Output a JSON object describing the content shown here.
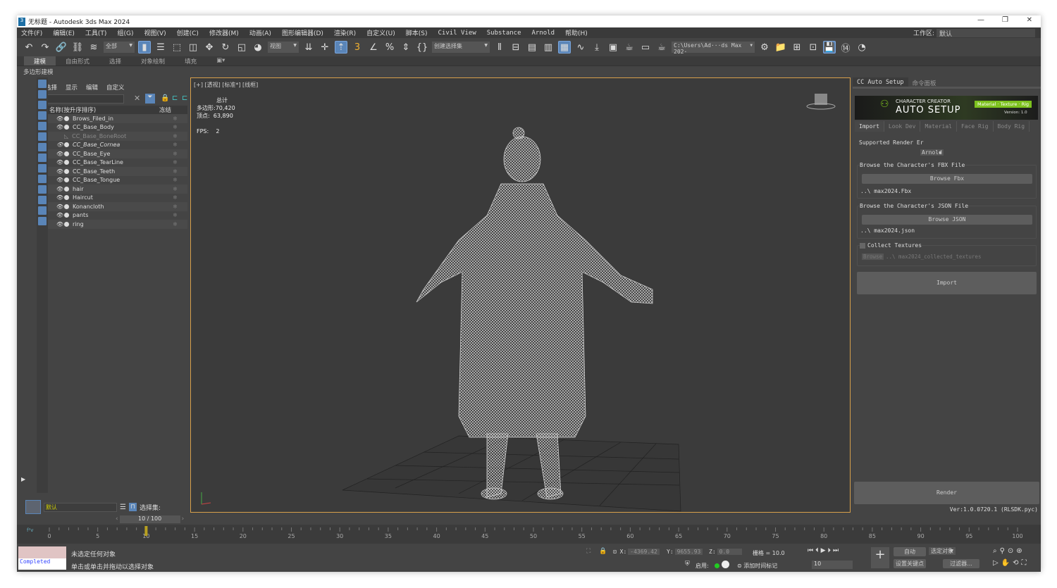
{
  "window": {
    "title": "无标题 - Autodesk 3ds Max 2024"
  },
  "menu": [
    "文件(F)",
    "编辑(E)",
    "工具(T)",
    "组(G)",
    "视图(V)",
    "创建(C)",
    "修改器(M)",
    "动画(A)",
    "图形编辑器(D)",
    "渲染(R)",
    "自定义(U)",
    "脚本(S)",
    "Civil View",
    "Substance",
    "Arnold",
    "帮助(H)"
  ],
  "workspace": {
    "label": "工作区:",
    "value": "默认"
  },
  "toolbar": {
    "filter": "全部",
    "refcoord": "视图",
    "selset": "创建选择集",
    "path": "C:\\Users\\Ad···ds Max 202·"
  },
  "ribbon": {
    "tabs": [
      "建模",
      "自由形式",
      "选择",
      "对象绘制",
      "填充"
    ],
    "active": 0,
    "sub": "多边形建模"
  },
  "explorer": {
    "menu": [
      "选择",
      "显示",
      "编辑",
      "自定义"
    ],
    "col_name": "名称(按升序排序)",
    "col_freeze": "冻结",
    "items": [
      {
        "name": "Brows_Filed_in"
      },
      {
        "name": "CC_Base_Body"
      },
      {
        "name": "CC_Base_BoneRoot",
        "hidden": true
      },
      {
        "name": "CC_Base_Cornea",
        "italic": true
      },
      {
        "name": "CC_Base_Eye"
      },
      {
        "name": "CC_Base_TearLine"
      },
      {
        "name": "CC_Base_Teeth"
      },
      {
        "name": "CC_Base_Tongue"
      },
      {
        "name": "hair"
      },
      {
        "name": "Haircut"
      },
      {
        "name": "Konancloth"
      },
      {
        "name": "pants"
      },
      {
        "name": "ring"
      }
    ],
    "layer": "默认",
    "selset_label": "选择集:"
  },
  "viewport": {
    "label": "[+] [透视] [标准*] [线框]",
    "stats_title": "总计",
    "poly_label": "多边形:",
    "poly": "70,420",
    "vert_label": "顶点:",
    "vert": "63,890",
    "fps_label": "FPS:",
    "fps": "2"
  },
  "panel": {
    "tabs": [
      "CC Auto Setup",
      "命令面板"
    ],
    "banner_top": "CHARACTER CREATOR",
    "banner_main": "AUTO SETUP",
    "banner_badge": "Material · Texture · Rig",
    "version_small": "Version: 1.0",
    "subtabs": [
      "Import",
      "Look Dev",
      "Material",
      "Face Rig",
      "Body Rig"
    ],
    "render_label": "Supported Render Er",
    "render_value": "Arnold",
    "fbx_title": "Browse the Character's FBX File",
    "fbx_btn": "Browse Fbx",
    "fbx_path": "..\\ max2024.Fbx",
    "json_title": "Browse the Character's JSON File",
    "json_btn": "Browse JSON",
    "json_path": "..\\ max2024.json",
    "collect": "Collect Textures",
    "collect_btn": "Browse",
    "collect_path": "..\\ max2024_collected_textures",
    "import": "Import",
    "render": "Render",
    "ver": "Ver:1.0.0720.1 (RLSDK.pyc)"
  },
  "timeline": {
    "frame": "10 / 100",
    "current": 10,
    "max": 100,
    "ticks": [
      "0",
      "5",
      "10",
      "15",
      "20",
      "25",
      "30",
      "35",
      "40",
      "45",
      "50",
      "55",
      "60",
      "65",
      "70",
      "75",
      "80",
      "85",
      "90",
      "95",
      "100"
    ]
  },
  "status": {
    "script": "Completed",
    "msg1": "未选定任何对象",
    "msg2": "单击或单击并拖动以选择对象",
    "x": "-4369.42",
    "y": "9655.93",
    "z": "0.0",
    "grid": "栅格 = 10.0",
    "enable": "启用:",
    "addtime": "添加时间标记",
    "auto": "自动",
    "setkey": "设置关键点",
    "selected": "选定对象",
    "filter": "过滤器...",
    "frame_field": "10"
  },
  "colors": {
    "accent": "#5a85b8",
    "active_frame": "#d8a04b",
    "banner_green": "#7dc21e"
  }
}
